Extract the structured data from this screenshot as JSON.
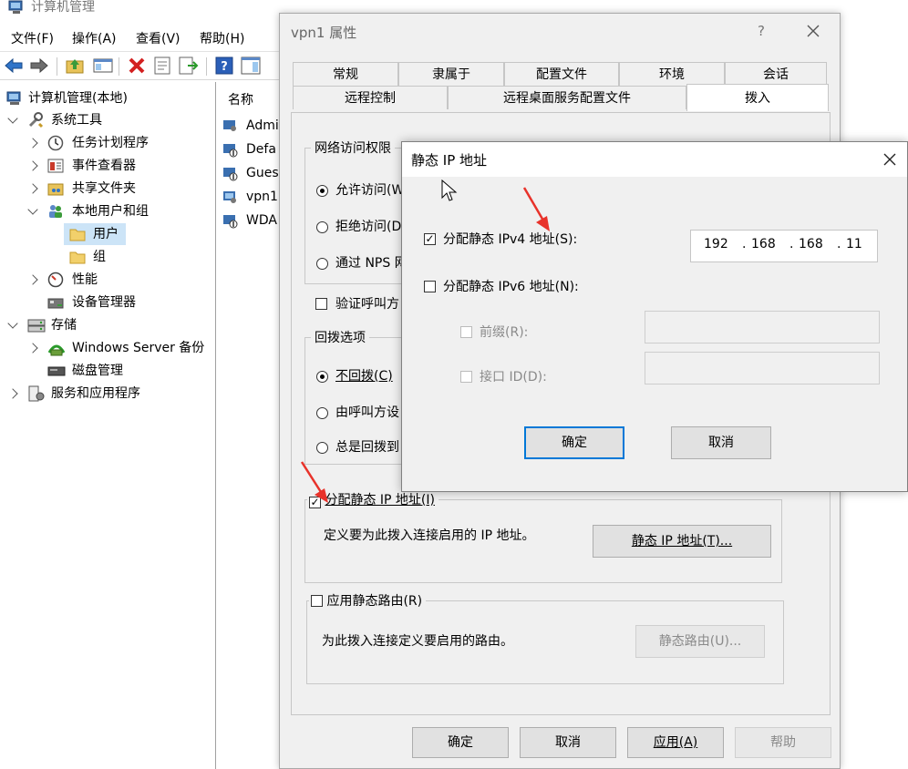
{
  "app": {
    "title": "计算机管理",
    "menu": [
      "文件(F)",
      "操作(A)",
      "查看(V)",
      "帮助(H)"
    ]
  },
  "tree": {
    "root": "计算机管理(本地)",
    "items": [
      {
        "label": "系统工具"
      },
      {
        "label": "任务计划程序"
      },
      {
        "label": "事件查看器"
      },
      {
        "label": "共享文件夹"
      },
      {
        "label": "本地用户和组"
      },
      {
        "label": "用户"
      },
      {
        "label": "组"
      },
      {
        "label": "性能"
      },
      {
        "label": "设备管理器"
      },
      {
        "label": "存储"
      },
      {
        "label": "Windows Server 备份"
      },
      {
        "label": "磁盘管理"
      },
      {
        "label": "服务和应用程序"
      }
    ]
  },
  "list": {
    "header": "名称",
    "rows": [
      "Admi",
      "Defa",
      "Gues",
      "vpn1",
      "WDA"
    ]
  },
  "props": {
    "title": "vpn1 属性",
    "help_glyph": "?",
    "tabs_row1": [
      "常规",
      "隶属于",
      "配置文件",
      "环境",
      "会话"
    ],
    "tabs_row2": [
      "远程控制",
      "远程桌面服务配置文件",
      "拨入"
    ],
    "access_group": "网络访问权限",
    "access_options": [
      "允许访问(W",
      "拒绝访问(D",
      "通过 NPS 网"
    ],
    "verify_caller": "验证呼叫方",
    "callback_group": "回拨选项",
    "callback_options": [
      "不回拨(C)",
      "由呼叫方设",
      "总是回拨到"
    ],
    "static_ip_check": "分配静态 IP 地址(I)",
    "static_ip_desc": "定义要为此拨入连接启用的 IP 地址。",
    "static_ip_button": "静态 IP 地址(T)...",
    "static_route_check": "应用静态路由(R)",
    "static_route_desc": "为此拨入连接定义要启用的路由。",
    "static_route_button": "静态路由(U)...",
    "buttons": {
      "ok": "确定",
      "cancel": "取消",
      "apply": "应用(A)",
      "help": "帮助"
    }
  },
  "ip_dialog": {
    "title": "静态 IP 地址",
    "ipv4_label": "分配静态 IPv4 地址(S):",
    "ipv4_checked": true,
    "ipv4_octets": [
      "192",
      "168",
      "168",
      "11"
    ],
    "ipv6_label": "分配静态 IPv6 地址(N):",
    "ipv6_checked": false,
    "prefix_label": "前缀(R):",
    "iface_label": "接口 ID(D):",
    "ok": "确定",
    "cancel": "取消"
  },
  "colors": {
    "annotation_arrow": "#e8322a",
    "selection": "#cce4f7",
    "focus_border": "#0078d7",
    "dialog_bg": "#f0f0f0"
  }
}
